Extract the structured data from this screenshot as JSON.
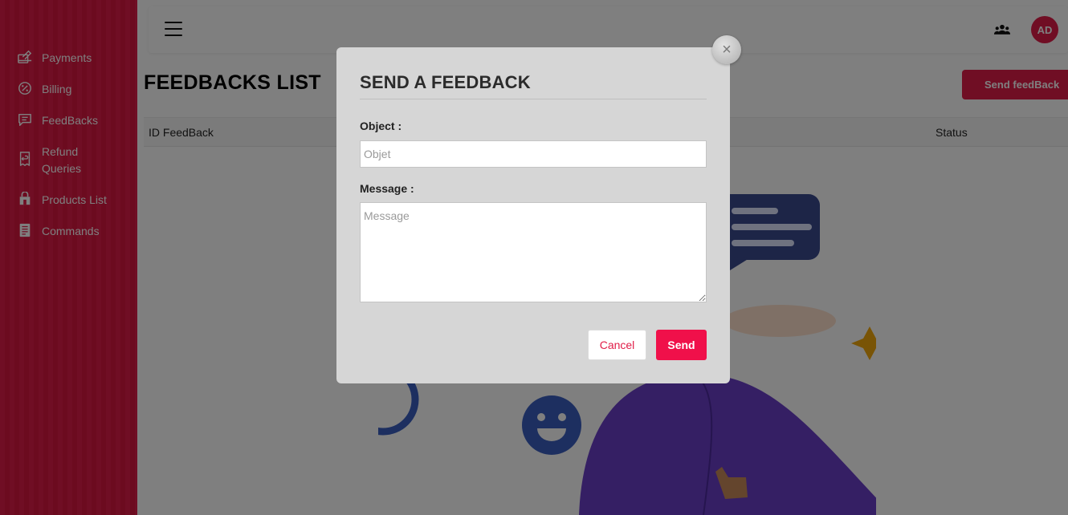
{
  "sidebar": {
    "items": [
      {
        "label": "Payments",
        "icon": "payments-icon"
      },
      {
        "label": "Billing",
        "icon": "billing-icon"
      },
      {
        "label": "FeedBacks",
        "icon": "feedback-icon"
      },
      {
        "label": "Refund Queries",
        "icon": "refund-icon"
      },
      {
        "label": "Products List",
        "icon": "store-icon"
      },
      {
        "label": "Commands",
        "icon": "commands-icon"
      }
    ]
  },
  "header": {
    "avatar_initials": "AD",
    "team_icon": "team-icon",
    "menu_icon": "hamburger-menu-icon"
  },
  "page": {
    "title": "FEEDBACKS LIST",
    "send_button": "Send feedBack",
    "columns": [
      "ID FeedBack",
      "Status"
    ]
  },
  "modal": {
    "title": "SEND A FEEDBACK",
    "object_label": "Object :",
    "object_placeholder": "Objet",
    "message_label": "Message :",
    "message_placeholder": "Message",
    "cancel_label": "Cancel",
    "send_label": "Send",
    "close_glyph": "×"
  },
  "colors": {
    "accent": "#e11d48",
    "send_button": "#f0104a",
    "modal_bg": "#d6d6d6"
  }
}
